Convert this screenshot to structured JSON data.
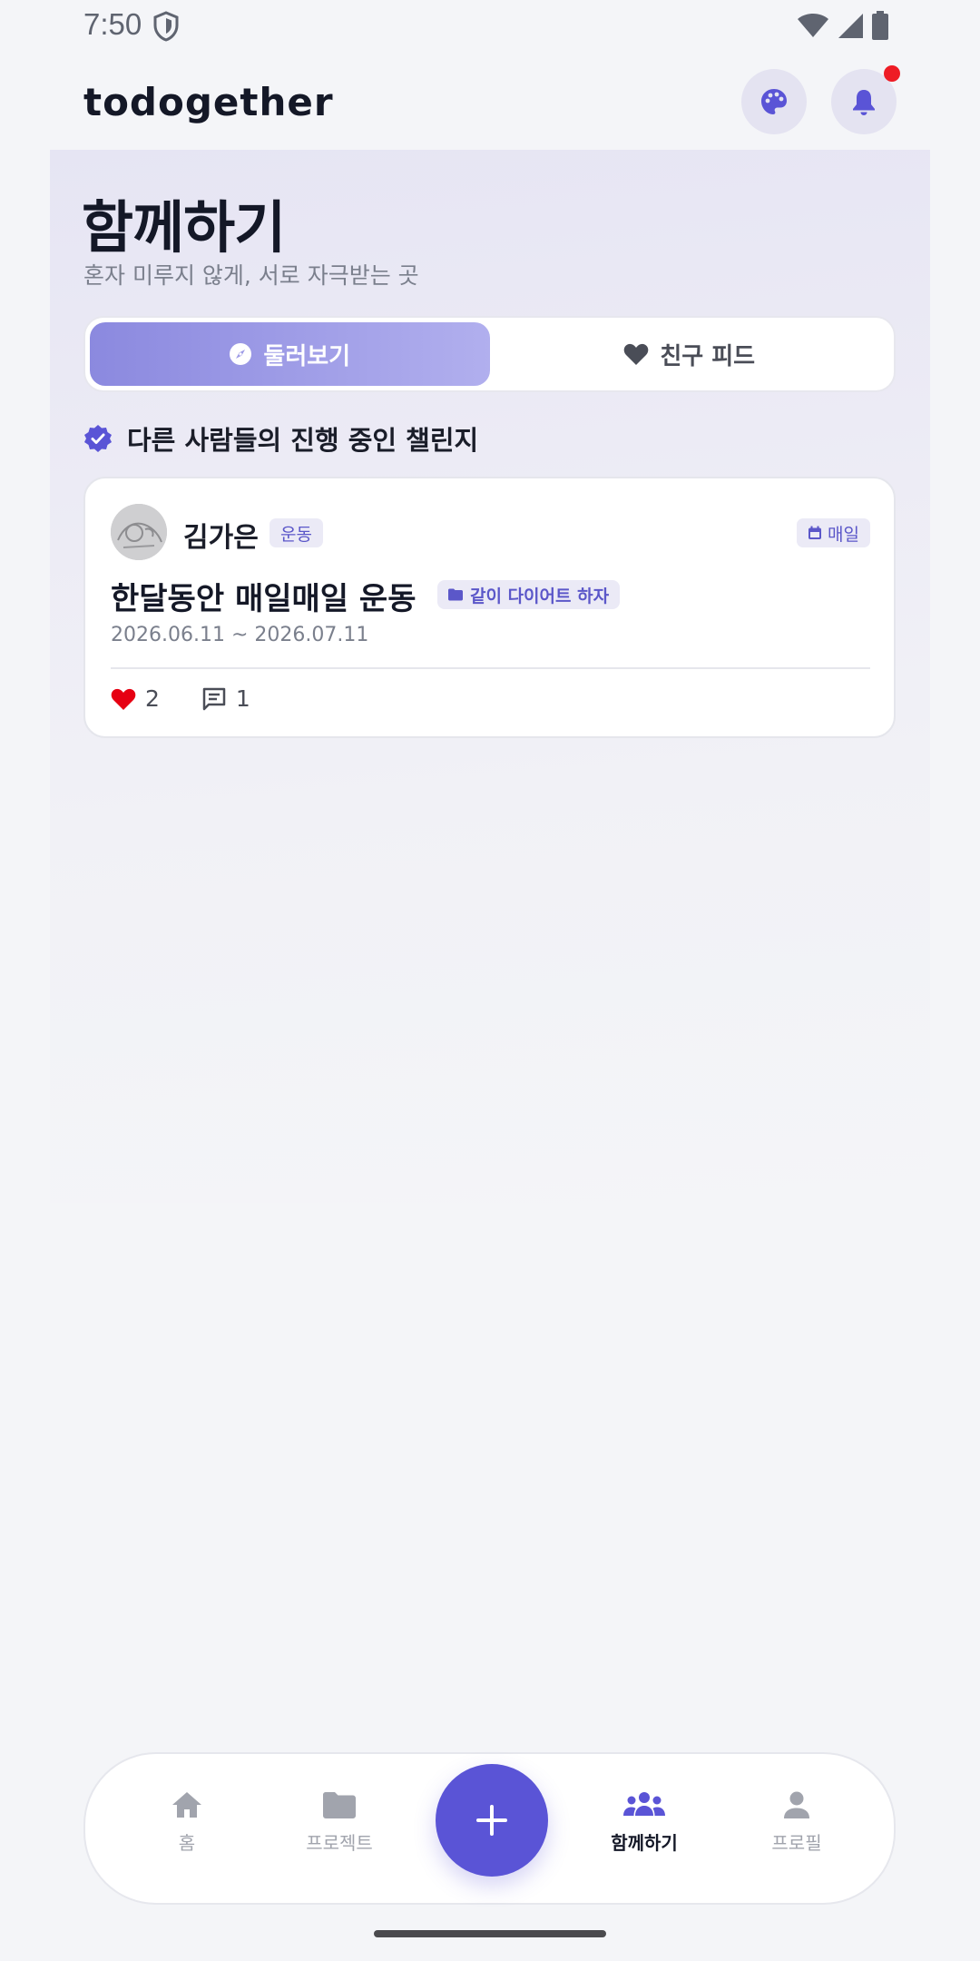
{
  "status_bar": {
    "time": "7:50"
  },
  "app": {
    "name": "todogether"
  },
  "header": {
    "title": "함께하기",
    "subtitle": "혼자 미루지 않게, 서로 자극받는 곳"
  },
  "tabs": [
    {
      "label": "둘러보기",
      "icon": "compass-icon",
      "active": true
    },
    {
      "label": "친구 피드",
      "icon": "heart-icon",
      "active": false
    }
  ],
  "section": {
    "label": "다른 사람들의 진행 중인 챌린지",
    "icon": "verified-badge-icon"
  },
  "challenges": [
    {
      "author": "김가은",
      "category": "운동",
      "frequency": "매일",
      "title": "한달동안 매일매일 운동",
      "project": "같이 다이어트 하자",
      "dates": "2026.06.11 ~ 2026.07.11",
      "likes": "2",
      "comments": "1"
    }
  ],
  "bottom_nav": [
    {
      "label": "홈",
      "icon": "home-icon",
      "active": false
    },
    {
      "label": "프로젝트",
      "icon": "folder-icon",
      "active": false
    },
    {
      "label": "함께하기",
      "icon": "group-icon",
      "active": true
    },
    {
      "label": "프로필",
      "icon": "person-icon",
      "active": false
    }
  ],
  "colors": {
    "accent": "#5a54d6",
    "tab_active_start": "#8b89df",
    "tab_active_end": "#b1afee",
    "notification": "#ee1c25",
    "heart": "#e60012"
  }
}
